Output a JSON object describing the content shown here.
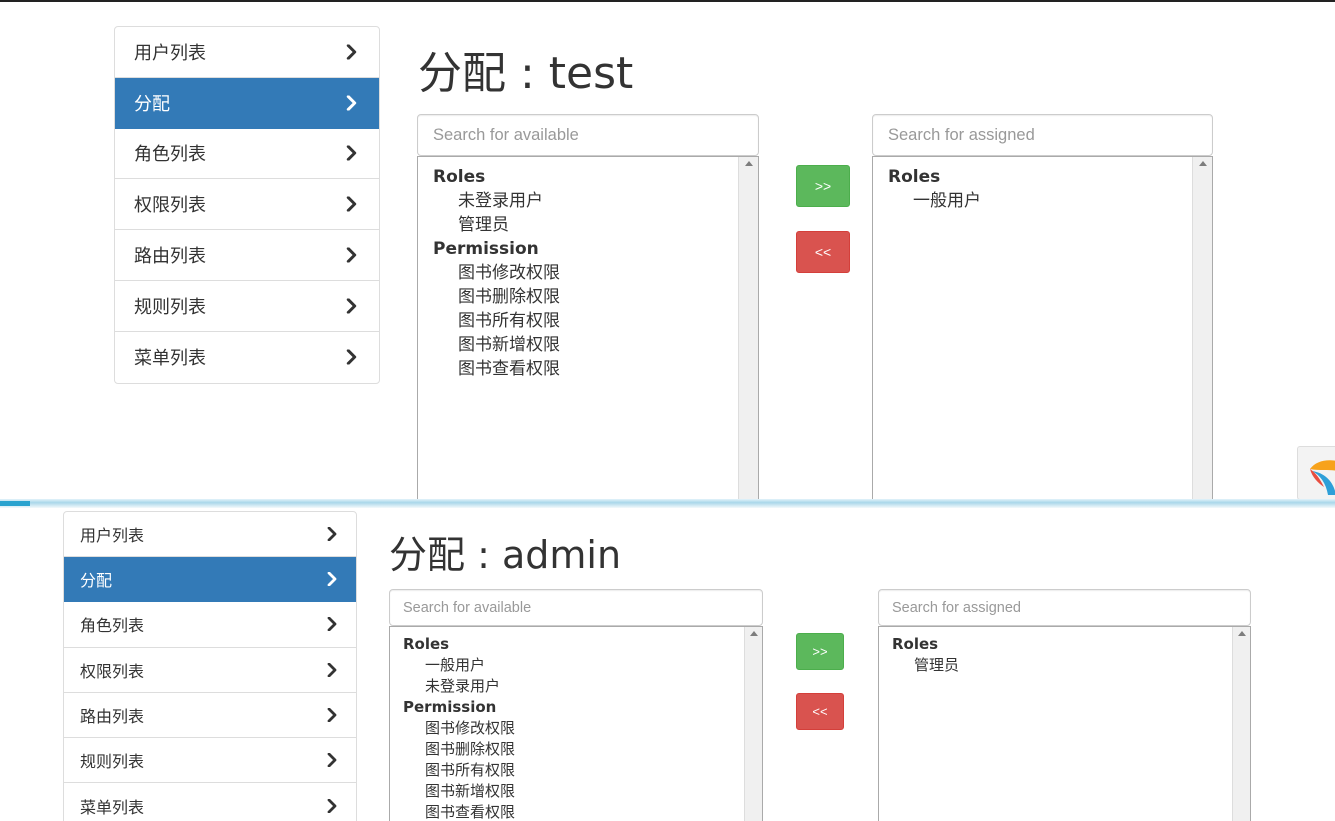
{
  "top": {
    "menu": [
      {
        "label": "用户列表",
        "active": false
      },
      {
        "label": "分配",
        "active": true
      },
      {
        "label": "角色列表",
        "active": false
      },
      {
        "label": "权限列表",
        "active": false
      },
      {
        "label": "路由列表",
        "active": false
      },
      {
        "label": "规则列表",
        "active": false
      },
      {
        "label": "菜单列表",
        "active": false
      }
    ],
    "title": "分配 : test",
    "available": {
      "placeholder": "Search for available",
      "groups": [
        {
          "label": "Roles",
          "items": [
            "未登录用户",
            "管理员"
          ]
        },
        {
          "label": "Permission",
          "items": [
            "图书修改权限",
            "图书删除权限",
            "图书所有权限",
            "图书新增权限",
            "图书查看权限"
          ]
        }
      ]
    },
    "assign_button": ">>",
    "remove_button": "<<",
    "assigned": {
      "placeholder": "Search for assigned",
      "groups": [
        {
          "label": "Roles",
          "items": [
            "一般用户"
          ]
        }
      ]
    }
  },
  "bottom": {
    "menu": [
      {
        "label": "用户列表",
        "active": false
      },
      {
        "label": "分配",
        "active": true
      },
      {
        "label": "角色列表",
        "active": false
      },
      {
        "label": "权限列表",
        "active": false
      },
      {
        "label": "路由列表",
        "active": false
      },
      {
        "label": "规则列表",
        "active": false
      },
      {
        "label": "菜单列表",
        "active": false
      }
    ],
    "title": "分配 : admin",
    "available": {
      "placeholder": "Search for available",
      "groups": [
        {
          "label": "Roles",
          "items": [
            "一般用户",
            "未登录用户"
          ]
        },
        {
          "label": "Permission",
          "items": [
            "图书修改权限",
            "图书删除权限",
            "图书所有权限",
            "图书新增权限",
            "图书查看权限"
          ]
        }
      ]
    },
    "assign_button": ">>",
    "remove_button": "<<",
    "assigned": {
      "placeholder": "Search for assigned",
      "groups": [
        {
          "label": "Roles",
          "items": [
            "管理员"
          ]
        }
      ]
    }
  },
  "colors": {
    "active_menu": "#337ab7",
    "assign_button": "#5cb85c",
    "remove_button": "#d9534f"
  },
  "icons": {
    "menu_chevron": "chevron-right-icon",
    "logo": "yii-logo-icon"
  }
}
